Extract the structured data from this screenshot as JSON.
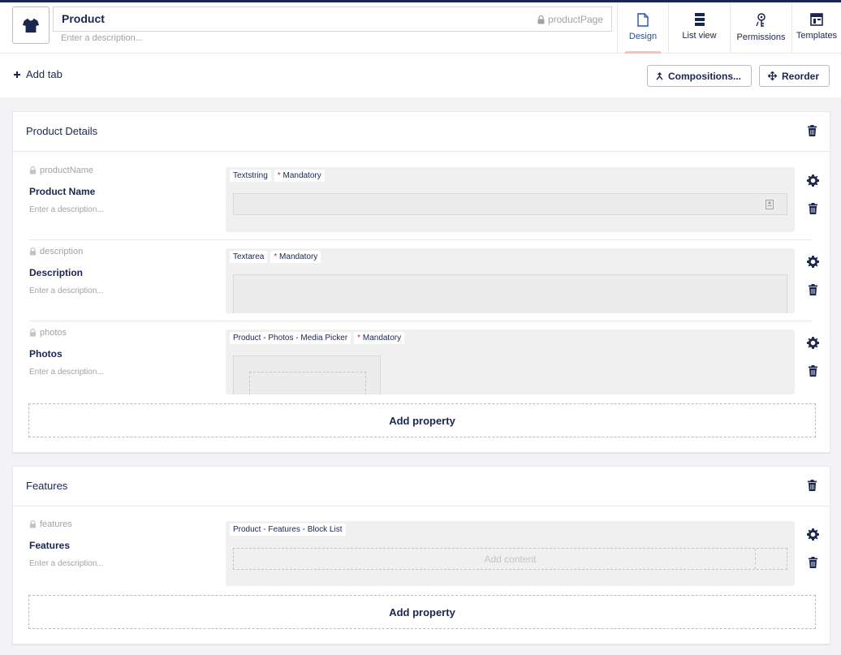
{
  "header": {
    "name": "Product",
    "alias": "productPage",
    "description_placeholder": "Enter a description...",
    "icon": "tshirt-icon"
  },
  "apps": [
    {
      "label": "Design",
      "icon": "document-icon",
      "active": true
    },
    {
      "label": "List view",
      "icon": "list-icon",
      "active": false
    },
    {
      "label": "Permissions",
      "icon": "key-icon",
      "active": false
    },
    {
      "label": "Templates",
      "icon": "layout-icon",
      "active": false
    }
  ],
  "toolbar": {
    "add_tab": "Add tab",
    "compositions": "Compositions...",
    "reorder": "Reorder"
  },
  "groups": [
    {
      "title": "Product Details",
      "properties": [
        {
          "alias": "productName",
          "name": "Product Name",
          "description_placeholder": "Enter a description...",
          "editor": "Textstring",
          "mandatory": "Mandatory"
        },
        {
          "alias": "description",
          "name": "Description",
          "description_placeholder": "Enter a description...",
          "editor": "Textarea",
          "mandatory": "Mandatory"
        },
        {
          "alias": "photos",
          "name": "Photos",
          "description_placeholder": "Enter a description...",
          "editor": "Product - Photos - Media Picker",
          "mandatory": "Mandatory"
        }
      ],
      "add_property": "Add property"
    },
    {
      "title": "Features",
      "properties": [
        {
          "alias": "features",
          "name": "Features",
          "description_placeholder": "Enter a description...",
          "editor": "Product - Features - Block List",
          "add_content": "Add content"
        }
      ],
      "add_property": "Add property"
    }
  ],
  "colors": {
    "primary": "#1b264f",
    "mandatory": "#d42054",
    "active_tab": "#f5c1bc"
  }
}
